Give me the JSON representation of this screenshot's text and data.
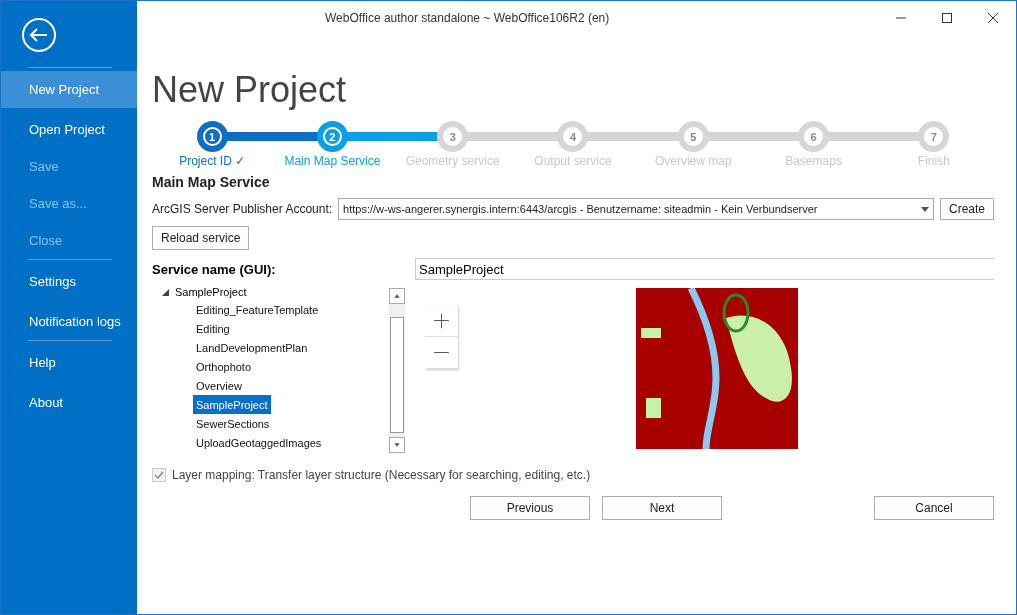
{
  "window": {
    "title": "WebOffice author standalone ~ WebOffice106R2 (en)"
  },
  "sidebar": {
    "groups": [
      {
        "items": [
          {
            "label": "New Project",
            "selected": true,
            "disabled": false
          },
          {
            "label": "Open Project",
            "selected": false,
            "disabled": false
          },
          {
            "label": "Save",
            "selected": false,
            "disabled": true
          },
          {
            "label": "Save as...",
            "selected": false,
            "disabled": true
          },
          {
            "label": "Close",
            "selected": false,
            "disabled": true
          }
        ]
      },
      {
        "items": [
          {
            "label": "Settings",
            "selected": false,
            "disabled": false
          },
          {
            "label": "Notification logs",
            "selected": false,
            "disabled": false
          }
        ]
      },
      {
        "items": [
          {
            "label": "Help",
            "selected": false,
            "disabled": false
          },
          {
            "label": "About",
            "selected": false,
            "disabled": false
          }
        ]
      }
    ]
  },
  "page_title": "New Project",
  "steps": [
    {
      "number": "1",
      "label": "Project ID ✓",
      "completed": true,
      "selected": false
    },
    {
      "number": "2",
      "label": "Main Map Service",
      "completed": false,
      "selected": true
    },
    {
      "number": "3",
      "label": "Geometry service",
      "completed": false,
      "selected": false
    },
    {
      "number": "4",
      "label": "Output service",
      "completed": false,
      "selected": false
    },
    {
      "number": "5",
      "label": "Overview map",
      "completed": false,
      "selected": false
    },
    {
      "number": "6",
      "label": "Basemaps",
      "completed": false,
      "selected": false
    },
    {
      "number": "7",
      "label": "Finish",
      "completed": false,
      "selected": false
    }
  ],
  "section_title": "Main Map Service",
  "account": {
    "label": "ArcGIS Server Publisher Account:",
    "value": "https://w-ws-angerer.synergis.intern:6443/arcgis  -  Benutzername: siteadmin - Kein Verbundserver",
    "button": "Create"
  },
  "reload_button": "Reload service",
  "service_name": {
    "label": "Service name (GUI):",
    "value": "SampleProject"
  },
  "tree": {
    "label": "SampleProject",
    "expanded": true,
    "children": [
      {
        "label": "Editing_FeatureTemplate",
        "selected": false
      },
      {
        "label": "Editing",
        "selected": false
      },
      {
        "label": "LandDevelopmentPlan",
        "selected": false
      },
      {
        "label": "Orthophoto",
        "selected": false
      },
      {
        "label": "Overview",
        "selected": false
      },
      {
        "label": "SampleProject",
        "selected": true
      },
      {
        "label": "SewerSections",
        "selected": false
      },
      {
        "label": "UploadGeotaggedImages",
        "selected": false
      }
    ]
  },
  "layer_mapping": {
    "label": "Layer mapping: Transfer layer structure (Necessary for searching, editing, etc.)",
    "checked": true,
    "disabled": true
  },
  "buttons": {
    "previous": "Previous",
    "next": "Next",
    "cancel": "Cancel"
  }
}
